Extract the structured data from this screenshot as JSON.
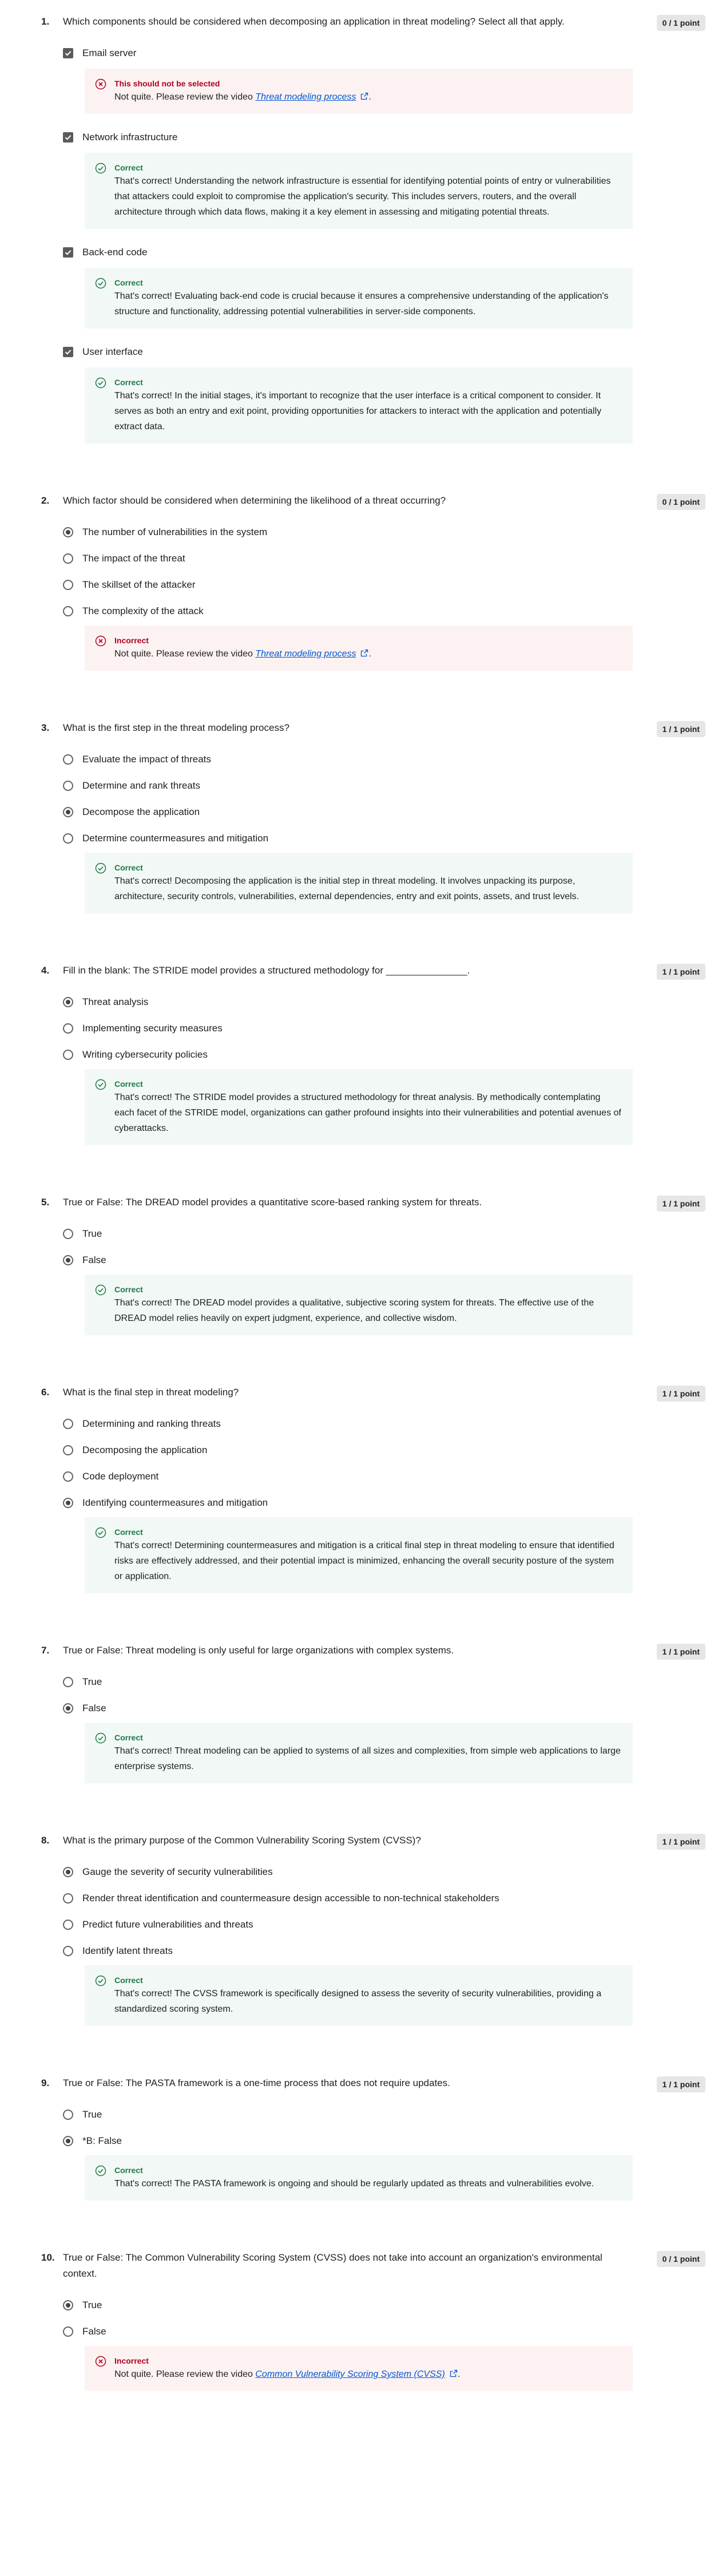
{
  "questions": [
    {
      "number": "1.",
      "text": "Which components should be considered when decomposing an application in threat modeling? Select all that apply.",
      "points": "0 / 1 point",
      "kind": "checkbox",
      "options": [
        {
          "label": "Email server",
          "feedback": {
            "status": "incorrect",
            "title": "This should not be selected",
            "text": "Not quite. Please review the video ",
            "link": "Threat modeling process",
            "after": "."
          }
        },
        {
          "label": "Network infrastructure",
          "feedback": {
            "status": "correct",
            "title": "Correct",
            "text": "That's correct! Understanding the network infrastructure is essential for identifying potential points of entry or vulnerabilities that attackers could exploit to compromise the application's security. This includes servers, routers, and the overall architecture through which data flows, making it a key element in assessing and mitigating potential threats."
          }
        },
        {
          "label": "Back-end code",
          "feedback": {
            "status": "correct",
            "title": "Correct",
            "text": "That's correct! Evaluating back-end code is crucial because it ensures a comprehensive understanding of the application's structure and functionality, addressing potential vulnerabilities in server-side components."
          }
        },
        {
          "label": "User interface",
          "feedback": {
            "status": "correct",
            "title": "Correct",
            "text": "That's correct! In the initial stages, it's important to recognize that the user interface is a critical component to consider. It serves as both an entry and exit point, providing opportunities for attackers to interact with the application and potentially extract data."
          }
        }
      ]
    },
    {
      "number": "2.",
      "text": "Which factor should be considered when determining the likelihood of a threat occurring?",
      "points": "0 / 1 point",
      "kind": "radio",
      "options": [
        {
          "label": "The number of vulnerabilities in the system",
          "selected": true
        },
        {
          "label": "The impact of the threat"
        },
        {
          "label": "The skillset of the attacker"
        },
        {
          "label": "The complexity of the attack"
        }
      ],
      "feedback": {
        "status": "incorrect",
        "title": "Incorrect",
        "text": "Not quite. Please review the video ",
        "link": "Threat modeling process",
        "after": "."
      }
    },
    {
      "number": "3.",
      "text": "What is the first step in the threat modeling process?",
      "points": "1 / 1 point",
      "kind": "radio",
      "options": [
        {
          "label": "Evaluate the impact of threats"
        },
        {
          "label": "Determine and rank threats"
        },
        {
          "label": "Decompose the application",
          "selected": true
        },
        {
          "label": "Determine countermeasures and mitigation"
        }
      ],
      "feedback": {
        "status": "correct",
        "title": "Correct",
        "text": "That's correct! Decomposing the application is the initial step in threat modeling. It involves unpacking its purpose, architecture, security controls, vulnerabilities, external dependencies, entry and exit points, assets, and trust levels."
      }
    },
    {
      "number": "4.",
      "text": "Fill in the blank: The STRIDE model provides a structured methodology for _______________.",
      "points": "1 / 1 point",
      "kind": "radio",
      "options": [
        {
          "label": "Threat analysis",
          "selected": true
        },
        {
          "label": "Implementing security measures"
        },
        {
          "label": "Writing cybersecurity policies"
        }
      ],
      "feedback": {
        "status": "correct",
        "title": "Correct",
        "text": "That's correct! The STRIDE model provides a structured methodology for threat analysis. By methodically contemplating each facet of the STRIDE model, organizations can gather profound insights into their vulnerabilities and potential avenues of cyberattacks."
      }
    },
    {
      "number": "5.",
      "text": "True or False: The DREAD model provides a quantitative score-based ranking system for threats.",
      "points": "1 / 1 point",
      "kind": "radio",
      "options": [
        {
          "label": "True"
        },
        {
          "label": "False",
          "selected": true
        }
      ],
      "feedback": {
        "status": "correct",
        "title": "Correct",
        "text": "That's correct! The DREAD model provides a qualitative, subjective scoring system for threats. The effective use of the DREAD model relies heavily on expert judgment, experience, and collective wisdom."
      }
    },
    {
      "number": "6.",
      "text": "What is the final step in threat modeling?",
      "points": "1 / 1 point",
      "kind": "radio",
      "options": [
        {
          "label": "Determining and ranking threats"
        },
        {
          "label": "Decomposing the application"
        },
        {
          "label": "Code deployment"
        },
        {
          "label": "Identifying countermeasures and mitigation",
          "selected": true
        }
      ],
      "feedback": {
        "status": "correct",
        "title": "Correct",
        "text": "That's correct! Determining countermeasures and mitigation is a critical final step in threat modeling to ensure that identified risks are effectively addressed, and their potential impact is minimized, enhancing the overall security posture of the system or application."
      }
    },
    {
      "number": "7.",
      "text": "True or False: Threat modeling is only useful for large organizations with complex systems.",
      "points": "1 / 1 point",
      "kind": "radio",
      "options": [
        {
          "label": "True"
        },
        {
          "label": "False",
          "selected": true
        }
      ],
      "feedback": {
        "status": "correct",
        "title": "Correct",
        "text": "That's correct! Threat modeling can be applied to systems of all sizes and complexities, from simple web applications to large enterprise systems."
      }
    },
    {
      "number": "8.",
      "text": "What is the primary purpose of the Common Vulnerability Scoring System (CVSS)?",
      "points": "1 / 1 point",
      "kind": "radio",
      "options": [
        {
          "label": "Gauge the severity of security vulnerabilities",
          "selected": true
        },
        {
          "label": "Render threat identification and countermeasure design accessible to non-technical stakeholders"
        },
        {
          "label": "Predict future vulnerabilities and threats"
        },
        {
          "label": "Identify latent threats"
        }
      ],
      "feedback": {
        "status": "correct",
        "title": "Correct",
        "text": "That's correct! The CVSS framework is specifically designed to assess the severity of security vulnerabilities, providing a standardized scoring system."
      }
    },
    {
      "number": "9.",
      "text": "True or False: The PASTA framework is a one-time process that does not require updates.",
      "points": "1 / 1 point",
      "kind": "radio",
      "options": [
        {
          "label": "True"
        },
        {
          "label": "*B: False",
          "selected": true
        }
      ],
      "feedback": {
        "status": "correct",
        "title": "Correct",
        "text": "That's correct! The PASTA framework is ongoing and should be regularly updated as threats and vulnerabilities evolve."
      }
    },
    {
      "number": "10.",
      "text": "True or False: The Common Vulnerability Scoring System (CVSS) does not take into account an organization's environmental context.",
      "points": "0 / 1 point",
      "kind": "radio",
      "options": [
        {
          "label": "True",
          "selected": true
        },
        {
          "label": "False"
        }
      ],
      "feedback": {
        "status": "incorrect",
        "title": "Incorrect",
        "text": "Not quite. Please review the video ",
        "link": "Common Vulnerability Scoring System (CVSS)",
        "after": "."
      }
    }
  ]
}
